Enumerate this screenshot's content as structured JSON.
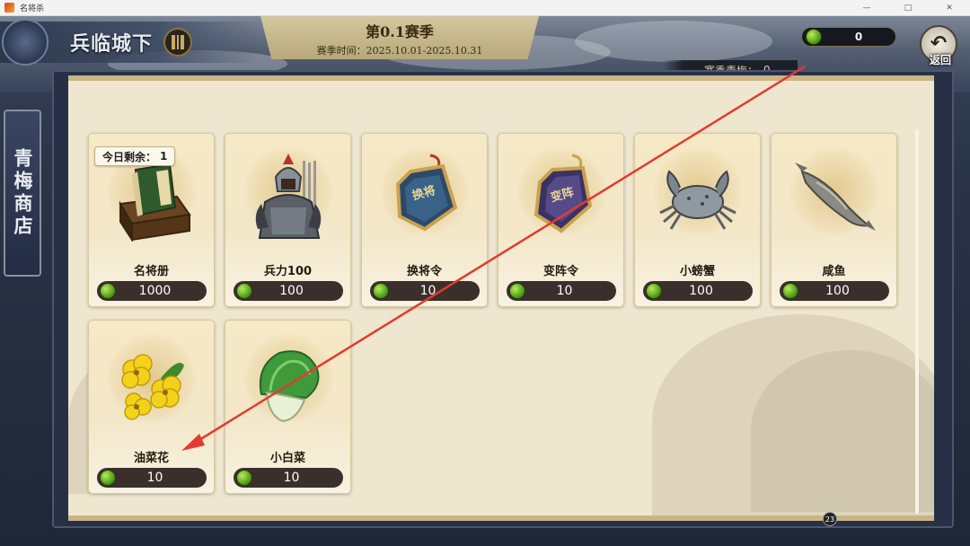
{
  "window": {
    "title": "名将杀"
  },
  "header": {
    "city_name": "兵临城下",
    "season_title": "第0.1赛季",
    "season_time": "赛季时间：2025.10.01-2025.10.31",
    "currency_value": "0",
    "back_label": "返回",
    "season_coin_label": "赛季青梅：",
    "season_coin_value": "0"
  },
  "sidebar": {
    "tab_label": "青梅商店"
  },
  "shop": {
    "items": [
      {
        "name": "名将册",
        "price": "1000",
        "icon": "book-chest-icon",
        "limit_label": "今日剩余：",
        "limit_value": "1"
      },
      {
        "name": "兵力100",
        "price": "100",
        "icon": "armored-soldier-icon"
      },
      {
        "name": "换将令",
        "price": "10",
        "icon": "swap-general-token-icon",
        "token_text": "换将"
      },
      {
        "name": "变阵令",
        "price": "10",
        "icon": "change-formation-token-icon",
        "token_text": "变阵"
      },
      {
        "name": "小螃蟹",
        "price": "100",
        "icon": "crab-icon"
      },
      {
        "name": "咸鱼",
        "price": "100",
        "icon": "salted-fish-icon"
      },
      {
        "name": "油菜花",
        "price": "10",
        "icon": "rapeseed-flower-icon"
      },
      {
        "name": "小白菜",
        "price": "10",
        "icon": "bok-choy-icon"
      }
    ],
    "page_indicator": "23"
  },
  "colors": {
    "annotation_arrow": "#e23b30",
    "currency_green": "#4c9a16",
    "panel_bg": "#efe6cf"
  }
}
